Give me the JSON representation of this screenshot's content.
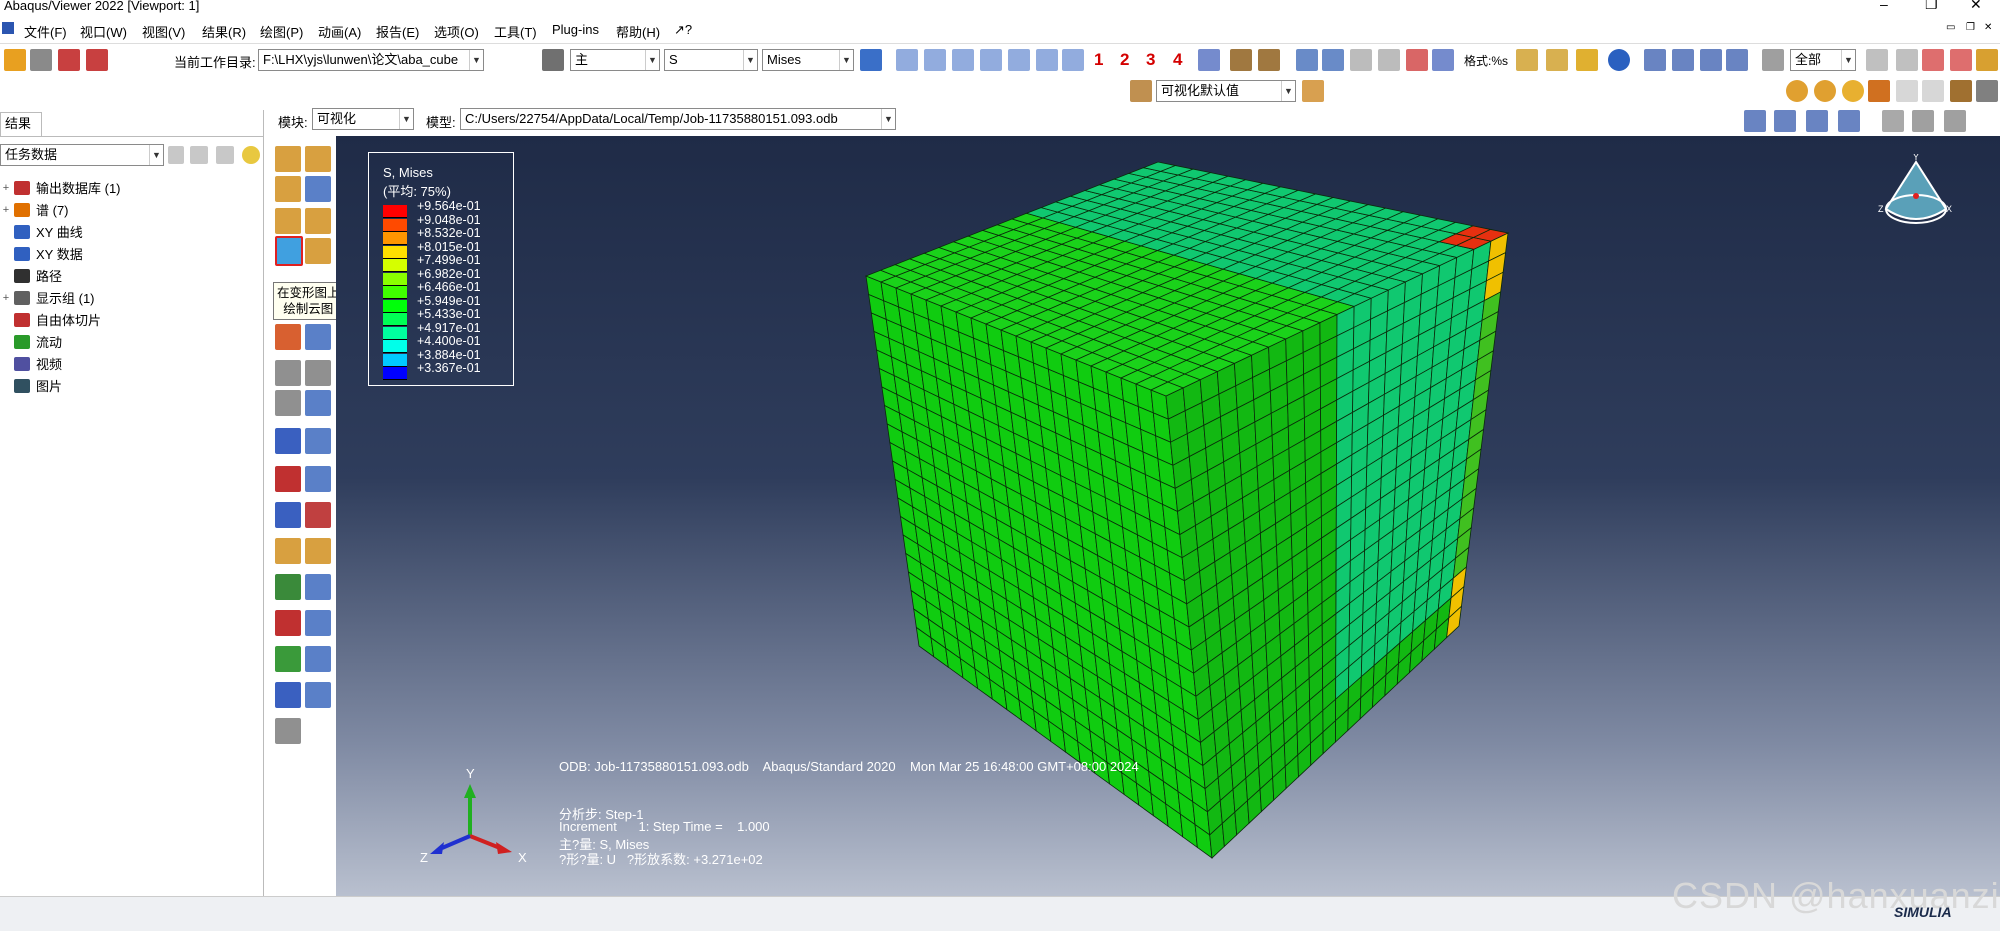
{
  "window": {
    "title": "Abaqus/Viewer 2022 [Viewport: 1]"
  },
  "menu": [
    "文件(F)",
    "视口(W)",
    "视图(V)",
    "结果(R)",
    "绘图(P)",
    "动画(A)",
    "报告(E)",
    "选项(O)",
    "工具(T)",
    "Plug-ins",
    "帮助(H)",
    "↗?"
  ],
  "toolbar": {
    "workdir_label": "当前工作目录:",
    "workdir_value": "F:\\LHX\\yjs\\lunwen\\论文\\aba_cube",
    "step_combo": "主",
    "var_combo": "S",
    "inv_combo": "Mises",
    "nums": [
      "1",
      "2",
      "3",
      "4"
    ],
    "style_label": "格式:%s",
    "scope_combo": "全部",
    "visual_default": "可视化默认值"
  },
  "context": {
    "module_label": "模块:",
    "module_value": "可视化",
    "model_label": "模型:",
    "model_value": "C:/Users/22754/AppData/Local/Temp/Job-11735880151.093.odb"
  },
  "tree": {
    "tab": "结果",
    "filter": "任务数据",
    "items": [
      {
        "label": "输出数据库 (1)",
        "icon": "database-icon",
        "color": "#c03030",
        "expand": "+"
      },
      {
        "label": "谱 (7)",
        "icon": "spectrum-icon",
        "color": "#e07000",
        "expand": "+"
      },
      {
        "label": "XY 曲线",
        "icon": "xy-plot-icon",
        "color": "#3060c0",
        "expand": ""
      },
      {
        "label": "XY 数据",
        "icon": "xy-data-icon",
        "color": "#3060c0",
        "expand": ""
      },
      {
        "label": "路径",
        "icon": "path-icon",
        "color": "#303030",
        "expand": ""
      },
      {
        "label": "显示组 (1)",
        "icon": "display-group-icon",
        "color": "#606060",
        "expand": "+"
      },
      {
        "label": "自由体切片",
        "icon": "free-body-icon",
        "color": "#c03030",
        "expand": ""
      },
      {
        "label": "流动",
        "icon": "stream-icon",
        "color": "#2a9a2a",
        "expand": ""
      },
      {
        "label": "视频",
        "icon": "movie-icon",
        "color": "#5050a0",
        "expand": ""
      },
      {
        "label": "图片",
        "icon": "image-icon",
        "color": "#305060",
        "expand": ""
      }
    ]
  },
  "tooltip": {
    "line1": "在变形图上",
    "line2": "绘制云图"
  },
  "legend": {
    "title": "S, Mises",
    "subtitle": "(平均: 75%)",
    "levels": [
      {
        "value": "+9.564e-01",
        "color": "#ff0000"
      },
      {
        "value": "+9.048e-01",
        "color": "#ff4a00"
      },
      {
        "value": "+8.532e-01",
        "color": "#ff9500"
      },
      {
        "value": "+8.015e-01",
        "color": "#ffdf00"
      },
      {
        "value": "+7.499e-01",
        "color": "#d5ff00"
      },
      {
        "value": "+6.982e-01",
        "color": "#8aff00"
      },
      {
        "value": "+6.466e-01",
        "color": "#40ff00"
      },
      {
        "value": "+5.949e-01",
        "color": "#00ff0a"
      },
      {
        "value": "+5.433e-01",
        "color": "#00ff55"
      },
      {
        "value": "+4.917e-01",
        "color": "#00ff9f"
      },
      {
        "value": "+4.400e-01",
        "color": "#00ffea"
      },
      {
        "value": "+3.884e-01",
        "color": "#00caff"
      },
      {
        "value": "+3.367e-01",
        "color": "#0000ff"
      }
    ]
  },
  "info": {
    "odb_line": "ODB: Job-11735880151.093.odb    Abaqus/Standard 2020    Mon Mar 25 16:48:00 GMT+08:00 2024",
    "step_line": "分析步: Step-1",
    "increment_line": "Increment      1: Step Time =    1.000",
    "primary_line": "主?量: S, Mises",
    "deform_line": "?形?量: U   ?形放系数: +3.271e+02"
  },
  "triad": {
    "x": "X",
    "y": "Y",
    "z": "Z"
  },
  "watermark": "CSDN @hanxuanzi",
  "brand": "SIMULIA",
  "colors": {
    "cube_base": "#10cc10",
    "cube_dark": "#0a9a0a",
    "cube_teal": "#10c870",
    "edge_red": "#e63010",
    "edge_yellow": "#f0c000"
  }
}
